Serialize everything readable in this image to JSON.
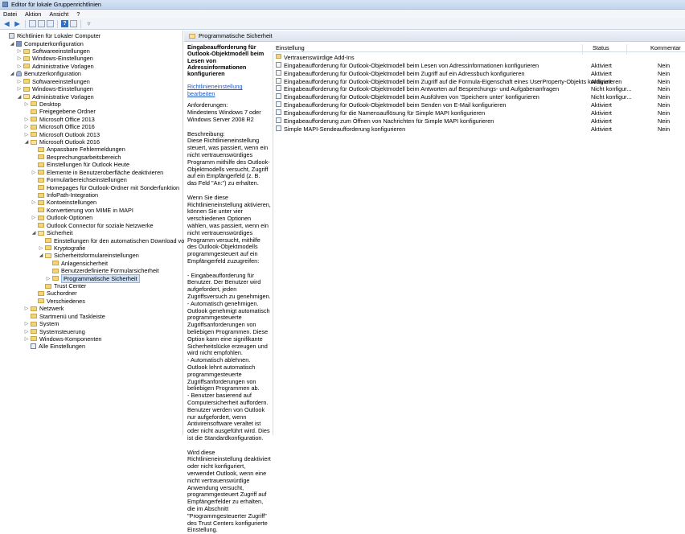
{
  "window": {
    "title": "Editor für lokale Gruppenrichtlinien"
  },
  "menu": [
    "Datei",
    "Aktion",
    "Ansicht",
    "?"
  ],
  "toolbar": {
    "buttons": [
      "back-icon",
      "forward-icon",
      "up-folder-icon",
      "show-hide-tree-icon",
      "export-list-icon",
      "help-icon",
      "properties-icon",
      "filter-icon"
    ]
  },
  "tree": [
    {
      "label": "Richtlinien für Lokaler Computer",
      "level": 0,
      "expander": "",
      "icon": "policy"
    },
    {
      "label": "Computerkonfiguration",
      "level": 1,
      "expander": "open",
      "icon": "computer"
    },
    {
      "label": "Softwareeinstellungen",
      "level": 2,
      "expander": "closed",
      "icon": "folder"
    },
    {
      "label": "Windows-Einstellungen",
      "level": 2,
      "expander": "closed",
      "icon": "folder"
    },
    {
      "label": "Administrative Vorlagen",
      "level": 2,
      "expander": "closed",
      "icon": "folder"
    },
    {
      "label": "Benutzerkonfiguration",
      "level": 1,
      "expander": "open",
      "icon": "user"
    },
    {
      "label": "Softwareeinstellungen",
      "level": 2,
      "expander": "closed",
      "icon": "folder"
    },
    {
      "label": "Windows-Einstellungen",
      "level": 2,
      "expander": "closed",
      "icon": "folder"
    },
    {
      "label": "Administrative Vorlagen",
      "level": 2,
      "expander": "open",
      "icon": "folder-open"
    },
    {
      "label": "Desktop",
      "level": 3,
      "expander": "closed",
      "icon": "folder"
    },
    {
      "label": "Freigegebene Ordner",
      "level": 3,
      "expander": "",
      "icon": "folder"
    },
    {
      "label": "Microsoft Office 2013",
      "level": 3,
      "expander": "closed",
      "icon": "folder"
    },
    {
      "label": "Microsoft Office 2016",
      "level": 3,
      "expander": "closed",
      "icon": "folder"
    },
    {
      "label": "Microsoft Outlook 2013",
      "level": 3,
      "expander": "closed",
      "icon": "folder"
    },
    {
      "label": "Microsoft Outlook 2016",
      "level": 3,
      "expander": "open",
      "icon": "folder-open"
    },
    {
      "label": "Anpassbare Fehlermeldungen",
      "level": 4,
      "expander": "",
      "icon": "folder"
    },
    {
      "label": "Besprechungsarbeitsbereich",
      "level": 4,
      "expander": "",
      "icon": "folder"
    },
    {
      "label": "Einstellungen für Outlook Heute",
      "level": 4,
      "expander": "",
      "icon": "folder"
    },
    {
      "label": "Elemente in Benutzeroberfläche deaktivieren",
      "level": 4,
      "expander": "closed",
      "icon": "folder"
    },
    {
      "label": "Formularbereichseinstellungen",
      "level": 4,
      "expander": "",
      "icon": "folder"
    },
    {
      "label": "Homepages für Outlook-Ordner mit Sonderfunktion",
      "level": 4,
      "expander": "",
      "icon": "folder"
    },
    {
      "label": "InfoPath-Integration",
      "level": 4,
      "expander": "",
      "icon": "folder"
    },
    {
      "label": "Kontoeinstellungen",
      "level": 4,
      "expander": "closed",
      "icon": "folder"
    },
    {
      "label": "Konvertierung von MIME in MAPI",
      "level": 4,
      "expander": "",
      "icon": "folder"
    },
    {
      "label": "Outlook-Optionen",
      "level": 4,
      "expander": "closed",
      "icon": "folder"
    },
    {
      "label": "Outlook Connector für soziale Netzwerke",
      "level": 4,
      "expander": "",
      "icon": "folder"
    },
    {
      "label": "Sicherheit",
      "level": 4,
      "expander": "open",
      "icon": "folder-open"
    },
    {
      "label": "Einstellungen für den automatischen Download von Bildern",
      "level": 5,
      "expander": "",
      "icon": "folder"
    },
    {
      "label": "Kryptografie",
      "level": 5,
      "expander": "closed",
      "icon": "folder"
    },
    {
      "label": "Sicherheitsformulareinstellungen",
      "level": 5,
      "expander": "open",
      "icon": "folder-open"
    },
    {
      "label": "Anlagensicherheit",
      "level": 6,
      "expander": "",
      "icon": "folder"
    },
    {
      "label": "Benutzerdefinierte Formularsicherheit",
      "level": 6,
      "expander": "",
      "icon": "folder"
    },
    {
      "label": "Programmatische Sicherheit",
      "level": 6,
      "expander": "closed",
      "icon": "folder",
      "selected": true
    },
    {
      "label": "Trust Center",
      "level": 5,
      "expander": "",
      "icon": "folder"
    },
    {
      "label": "Suchordner",
      "level": 4,
      "expander": "",
      "icon": "folder"
    },
    {
      "label": "Verschiedenes",
      "level": 4,
      "expander": "",
      "icon": "folder"
    },
    {
      "label": "Netzwerk",
      "level": 3,
      "expander": "closed",
      "icon": "folder"
    },
    {
      "label": "Startmenü und Taskleiste",
      "level": 3,
      "expander": "",
      "icon": "folder"
    },
    {
      "label": "System",
      "level": 3,
      "expander": "closed",
      "icon": "folder"
    },
    {
      "label": "Systemsteuerung",
      "level": 3,
      "expander": "closed",
      "icon": "folder"
    },
    {
      "label": "Windows-Komponenten",
      "level": 3,
      "expander": "closed",
      "icon": "folder"
    },
    {
      "label": "Alle Einstellungen",
      "level": 3,
      "expander": "",
      "icon": "all-settings"
    }
  ],
  "pane_header": "Programmatische Sicherheit",
  "description": {
    "title": "Eingabeaufforderung für Outlook-Objektmodell beim Lesen von Adressinformationen konfigurieren",
    "edit_link": "Richtlinieneinstellung bearbeiten",
    "body": "Anforderungen:\nMindestens Windows 7 oder Windows Server 2008 R2\n\nBeschreibung:\nDiese Richtlinieneinstellung steuert, was passiert, wenn ein nicht vertrauenswürdiges Programm mithilfe des Outlook-Objektmodells versucht, Zugriff auf ein Empfängerfeld (z. B. das Feld \"An:\") zu erhalten.\n\nWenn Sie diese Richtlinieneinstellung aktivieren, können Sie unter vier verschiedenen Optionen wählen, was passiert, wenn ein nicht vertrauenswürdiges Programm versucht, mithilfe des Outlook-Objektmodells programmgesteuert auf ein Empfängerfeld zuzugreifen:\n\n- Eingabeaufforderung für Benutzer. Der Benutzer wird aufgefordert, jeden Zugriffsversuch zu genehmigen.\n- Automatisch genehmigen. Outlook genehmigt automatisch programmgesteuerte Zugriffsanforderungen von beliebigen Programmen. Diese Option kann eine signifikante Sicherheitslücke erzeugen und wird nicht empfohlen.\n- Automatisch ablehnen. Outlook lehnt automatisch programmgesteuerte Zugriffsanforderungen von beliebigen Programmen ab.\n- Benutzer basierend auf Computersicherheit auffordern. Benutzer werden von Outlook nur aufgefordert, wenn Antivirensoftware veraltet ist oder nicht ausgeführt wird. Dies ist die Standardkonfiguration.\n\nWird diese Richtlinieneinstellung deaktiviert oder nicht konfiguriert, verwendet Outlook, wenn eine nicht vertrauenswürdige Anwendung versucht, programmgesteuert Zugriff auf Empfängerfelder zu erhalten, die im Abschnitt \"Programmgesteuerter Zugriff\" des Trust Centers konfigurierte Einstellung."
  },
  "list": {
    "columns": {
      "setting": "Einstellung",
      "status": "Status",
      "comment": "Kommentar"
    },
    "rows": [
      {
        "setting": "Vertrauenswürdige Add-Ins",
        "status": "",
        "comment": "",
        "icon": "folder"
      },
      {
        "setting": "Eingabeaufforderung für Outlook-Objektmodell beim Lesen von Adressinformationen konfigurieren",
        "status": "Aktiviert",
        "comment": "Nein",
        "icon": "setting"
      },
      {
        "setting": "Eingabeaufforderung für Outlook-Objektmodell beim Zugriff auf ein Adressbuch konfigurieren",
        "status": "Aktiviert",
        "comment": "Nein",
        "icon": "setting"
      },
      {
        "setting": "Eingabeaufforderung für Outlook-Objektmodell beim Zugriff auf die Formula-Eigenschaft eines UserProperty-Objekts konfigurieren",
        "status": "Aktiviert",
        "comment": "Nein",
        "icon": "setting"
      },
      {
        "setting": "Eingabeaufforderung für Outlook-Objektmodell beim Antworten auf Besprechungs- und Aufgabenanfragen",
        "status": "Nicht konfigur...",
        "comment": "Nein",
        "icon": "setting"
      },
      {
        "setting": "Eingabeaufforderung für Outlook-Objektmodell beim Ausführen von 'Speichern unter' konfigurieren",
        "status": "Nicht konfigur...",
        "comment": "Nein",
        "icon": "setting"
      },
      {
        "setting": "Eingabeaufforderung für Outlook-Objektmodell beim Senden von E-Mail konfigurieren",
        "status": "Aktiviert",
        "comment": "Nein",
        "icon": "setting"
      },
      {
        "setting": "Eingabeaufforderung für die Namensauflösung für Simple MAPI konfigurieren",
        "status": "Aktiviert",
        "comment": "Nein",
        "icon": "setting"
      },
      {
        "setting": "Eingabeaufforderung zum Öffnen von Nachrichten für Simple MAPI konfigurieren",
        "status": "Aktiviert",
        "comment": "Nein",
        "icon": "setting"
      },
      {
        "setting": "Simple MAPI-Sendeaufforderung konfigurieren",
        "status": "Aktiviert",
        "comment": "Nein",
        "icon": "setting"
      }
    ]
  }
}
